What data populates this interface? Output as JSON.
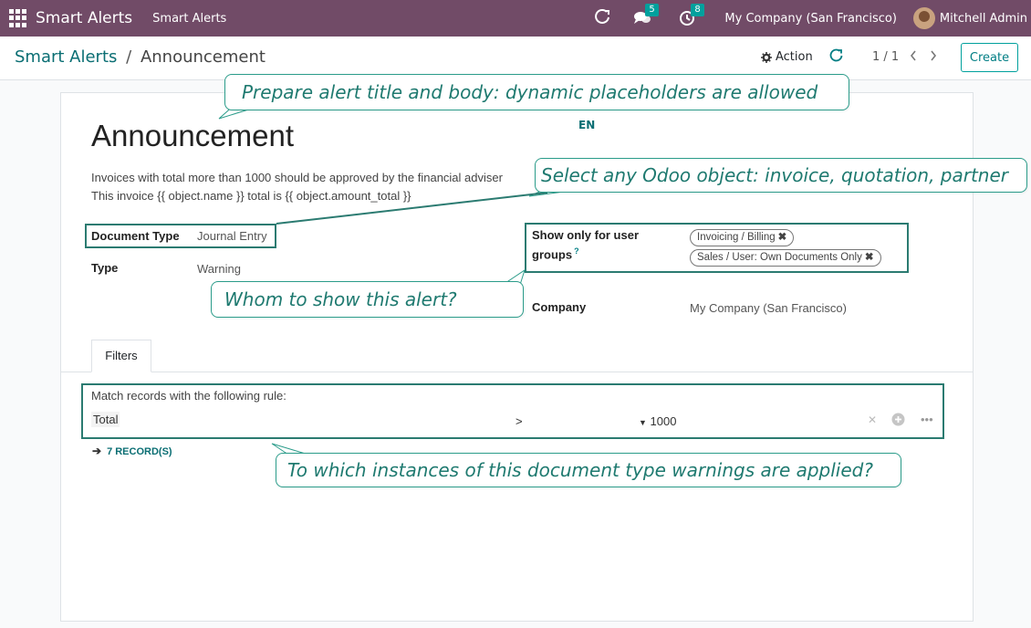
{
  "navbar": {
    "brand": "Smart Alerts",
    "menu": "Smart Alerts",
    "messages_count": "5",
    "activities_count": "8",
    "company": "My Company (San Francisco)",
    "user": "Mitchell Admin"
  },
  "control_panel": {
    "breadcrumb_parent": "Smart Alerts",
    "breadcrumb_separator": "/",
    "breadcrumb_current": "Announcement",
    "action_label": "Action",
    "pager": "1 / 1",
    "create_label": "Create"
  },
  "form": {
    "title": "Announcement",
    "lang": "EN",
    "body_line1": "Invoices with total more than 1000 should be approved by the financial adviser",
    "body_line2": "This invoice {{ object.name }} total is {{ object.amount_total }}",
    "document_type_label": "Document Type",
    "document_type_value": "Journal Entry",
    "type_label": "Type",
    "type_value": "Warning",
    "groups_label_1": "Show only for user",
    "groups_label_2": "groups",
    "groups_help": "?",
    "groups": [
      "Invoicing / Billing",
      "Sales / User: Own Documents Only"
    ],
    "company_label": "Company",
    "company_value": "My Company (San Francisco)"
  },
  "tabs": {
    "filters": "Filters"
  },
  "filters": {
    "rule_label": "Match records with the following rule:",
    "field": "Total",
    "operator": ">",
    "value": "1000",
    "records_link": "7 RECORD(S)"
  },
  "callouts": {
    "title_body": "Prepare alert title and body: dynamic placeholders are allowed",
    "object": "Select any Odoo object: invoice, quotation, partner",
    "whom": "Whom to show this alert?",
    "instances": "To which instances of this document type warnings are applied?"
  },
  "colors": {
    "navbar": "#714b67",
    "accent": "#017e84",
    "annotation": "#2b7b71"
  }
}
